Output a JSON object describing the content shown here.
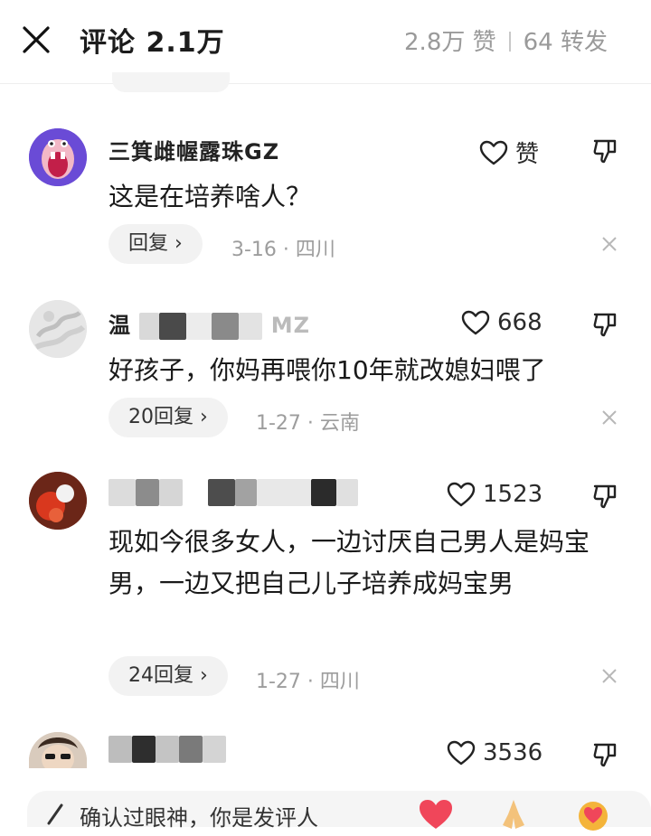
{
  "header": {
    "title": "评论 2.1万",
    "likes": "2.8万 赞",
    "shares": "64 转发"
  },
  "comments": [
    {
      "username": "三箕雌幄露珠GZ",
      "likes": "赞",
      "content": "这是在培养啥人？",
      "reply_label": "回复",
      "meta": "3-16 · 四川"
    },
    {
      "username_visible": "温",
      "username_tail": "MZ",
      "likes": "668",
      "content": "好孩子，你妈再喂你10年就改媳妇喂了",
      "reply_label": "20回复",
      "meta": "1-27 · 云南"
    },
    {
      "likes": "1523",
      "content": "现如今很多女人，一边讨厌自己男人是妈宝男，一边又把自己儿子培养成妈宝男",
      "reply_label": "24回复",
      "meta": "1-27 · 四川"
    },
    {
      "likes": "3536"
    }
  ],
  "input": {
    "placeholder": "确认过眼神，你是发评人"
  },
  "colors": {
    "muted": "#9a9a9a",
    "pill_bg": "#f2f2f2",
    "avatar_purple": "#6a4bd6"
  }
}
